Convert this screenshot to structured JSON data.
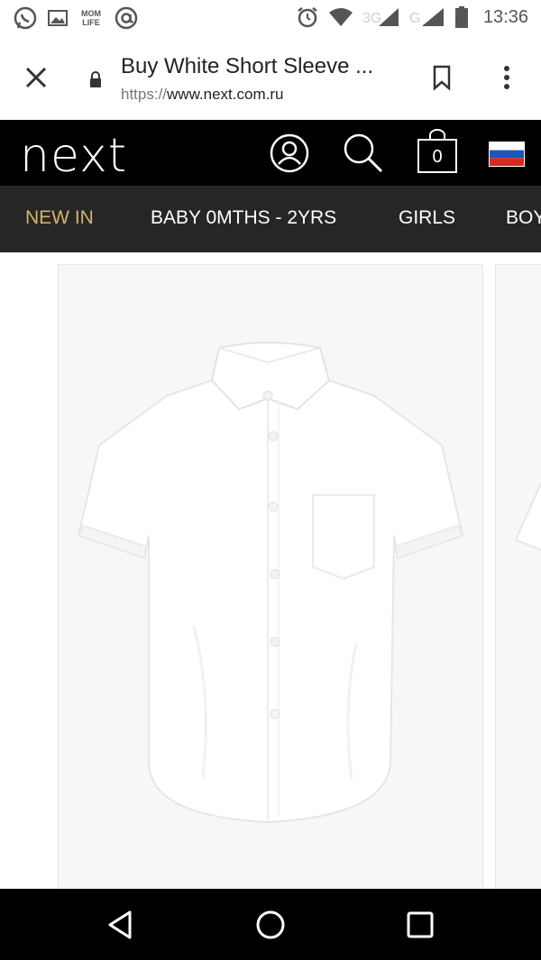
{
  "status_bar": {
    "left_icons": [
      "whatsapp-icon",
      "gallery-icon",
      "mom-life-icon",
      "at-icon"
    ],
    "mom_life_text": "MOM LIFE",
    "right_icons": [
      "alarm-icon",
      "wifi-icon",
      "signal-3g-icon",
      "signal-icon",
      "battery-icon"
    ],
    "time": "13:36"
  },
  "browser": {
    "page_title": "Buy White Short Sleeve ...",
    "url_protocol": "https://",
    "url_host": "www.next.com.ru"
  },
  "site_header": {
    "logo_text": "next",
    "bag_count": "0"
  },
  "nav": {
    "items": [
      {
        "label": "NEW IN",
        "active": true
      },
      {
        "label": "BABY 0MTHS - 2YRS",
        "active": false
      },
      {
        "label": "GIRLS",
        "active": false
      },
      {
        "label": "BOYS",
        "active": false
      }
    ]
  },
  "colors": {
    "header_bg": "#000000",
    "nav_bg": "#262626",
    "nav_active": "#d3b46a",
    "card_bg": "#f7f7f7"
  }
}
